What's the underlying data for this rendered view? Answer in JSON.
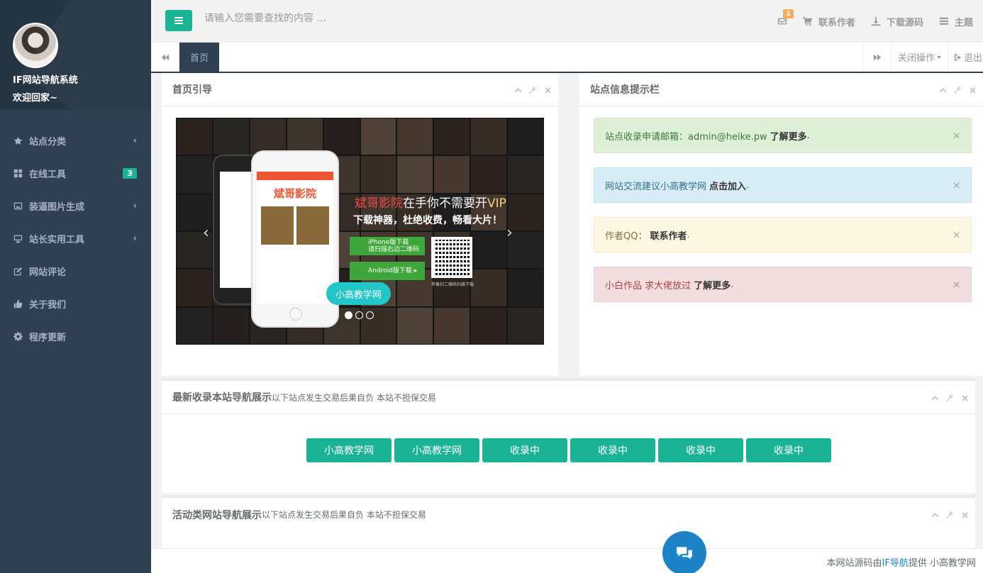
{
  "sidebar": {
    "site_name": "IF网站导航系统",
    "welcome": "欢迎回家~",
    "items": [
      {
        "label": "站点分类",
        "icon": "star-icon",
        "has_arrow": true
      },
      {
        "label": "在线工具",
        "icon": "grid-icon",
        "badge": "3"
      },
      {
        "label": "装逼图片生成",
        "icon": "image-icon",
        "has_arrow": true
      },
      {
        "label": "站长实用工具",
        "icon": "desktop-icon",
        "has_arrow": true
      },
      {
        "label": "网站评论",
        "icon": "edit-icon"
      },
      {
        "label": "关于我们",
        "icon": "thumbs-up-icon"
      },
      {
        "label": "程序更新",
        "icon": "gear-icon"
      }
    ],
    "arrow": "‹"
  },
  "topbar": {
    "search_placeholder": "请输入您需要查找的内容 …",
    "mail_count": "1",
    "contact_author": "联系作者",
    "download_source": "下载源码",
    "theme": "主题"
  },
  "tabs": {
    "home": "首页",
    "close_ops": "关闭操作",
    "exit": "退出"
  },
  "panels": {
    "guide": {
      "title": "首页引导",
      "carousel": {
        "brand": "斌哥影院",
        "headline_brand": "斌哥影院",
        "headline_rest": "在手你不需要开",
        "headline_vip": "VIP",
        "subline": "下载神器，杜绝收费，畅看大片！",
        "iphone_btn_1": "iPhone版下载",
        "iphone_btn_2": "请扫描右边二维码",
        "android_btn": "Android版下载 ▸",
        "qr_caption": "苹果扫二维码扫描下载",
        "caption": "小高教学网",
        "prev": "‹",
        "next": "›",
        "slide_count": 3,
        "active_slide": 1
      }
    },
    "info": {
      "title": "站点信息提示栏",
      "alerts": [
        {
          "type": "success",
          "text": "站点收录申请邮箱：admin@heike.pw",
          "link": "了解更多",
          "tail": "."
        },
        {
          "type": "info",
          "text": "网站交流建议小高教学网",
          "link": "点击加入",
          "tail": "."
        },
        {
          "type": "warning",
          "text": "作者QQ：",
          "link": "联系作者",
          "tail": "."
        },
        {
          "type": "danger",
          "text": "小白作品 求大佬放过",
          "link": "了解更多",
          "tail": "."
        }
      ],
      "close_glyph": "×"
    },
    "latest": {
      "title": "最新收录本站导航展示",
      "subtitle": "以下站点发生交易后果自负 本站不担保交易",
      "buttons": [
        "小高教学网",
        "小高教学网",
        "收录中",
        "收录中",
        "收录中",
        "收录中"
      ]
    },
    "activity": {
      "title": "活动类网站导航展示",
      "subtitle": "以下站点发生交易后果自负 本站不担保交易"
    }
  },
  "footer": {
    "prefix": "本网站源码由",
    "link": "IF导航",
    "suffix": "提供 小高教学网"
  },
  "colors": {
    "sidebar": "#2f4050",
    "accent": "#1ab394",
    "fab": "#1c84c6"
  }
}
